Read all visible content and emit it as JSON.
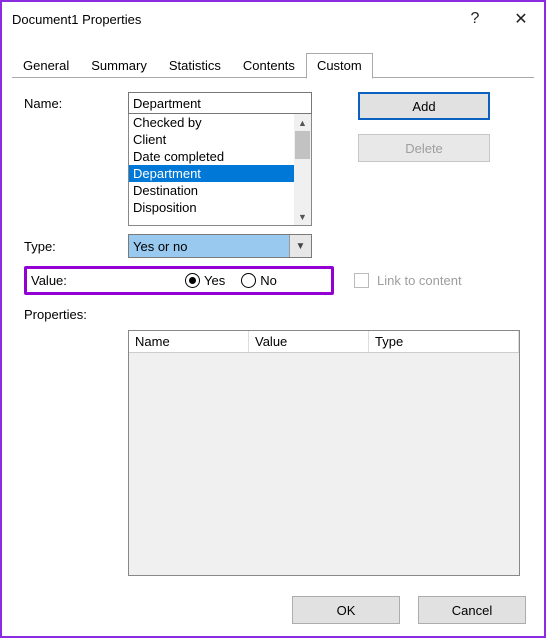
{
  "window": {
    "title": "Document1 Properties",
    "help_icon": "?",
    "close_icon": "✕"
  },
  "tabs": {
    "items": [
      "General",
      "Summary",
      "Statistics",
      "Contents",
      "Custom"
    ],
    "activeIndex": 4
  },
  "name_field": {
    "label": "Name:",
    "value": "Department",
    "suggestions": [
      "Checked by",
      "Client",
      "Date completed",
      "Department",
      "Destination",
      "Disposition"
    ],
    "selectedIndex": 3
  },
  "buttons": {
    "add": "Add",
    "delete": "Delete"
  },
  "type_field": {
    "label": "Type:",
    "value": "Yes or no"
  },
  "value_field": {
    "label": "Value:",
    "options": {
      "yes": "Yes",
      "no": "No"
    },
    "selected": "yes"
  },
  "link_content": {
    "label": "Link to content",
    "enabled": false
  },
  "properties": {
    "label": "Properties:",
    "columns": {
      "name": "Name",
      "value": "Value",
      "type": "Type"
    },
    "rows": []
  },
  "footer": {
    "ok": "OK",
    "cancel": "Cancel"
  }
}
